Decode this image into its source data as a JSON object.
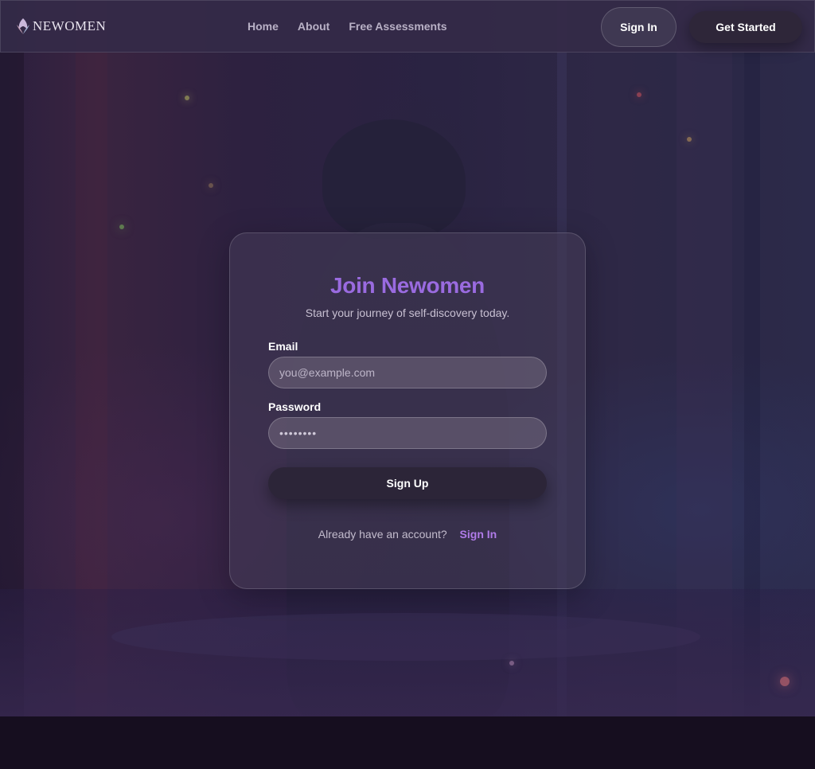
{
  "nav": {
    "logo_text": "NEWOMEN",
    "links": [
      "Home",
      "About",
      "Free Assessments"
    ],
    "signin_label": "Sign In",
    "getstarted_label": "Get Started"
  },
  "signup_card": {
    "title": "Join Newomen",
    "subtitle": "Start your journey of self-discovery today.",
    "email": {
      "label": "Email",
      "placeholder": "you@example.com",
      "value": ""
    },
    "password": {
      "label": "Password",
      "value": "••••••••"
    },
    "submit_label": "Sign Up",
    "account_prompt": "Already have an account?",
    "account_link": "Sign In"
  },
  "colors": {
    "accent_title": "#9a6be0",
    "accent_link": "#b07be8",
    "nav_bg": "#342a48",
    "card_bg": "#463c58",
    "footer_bg": "#160e1f"
  }
}
